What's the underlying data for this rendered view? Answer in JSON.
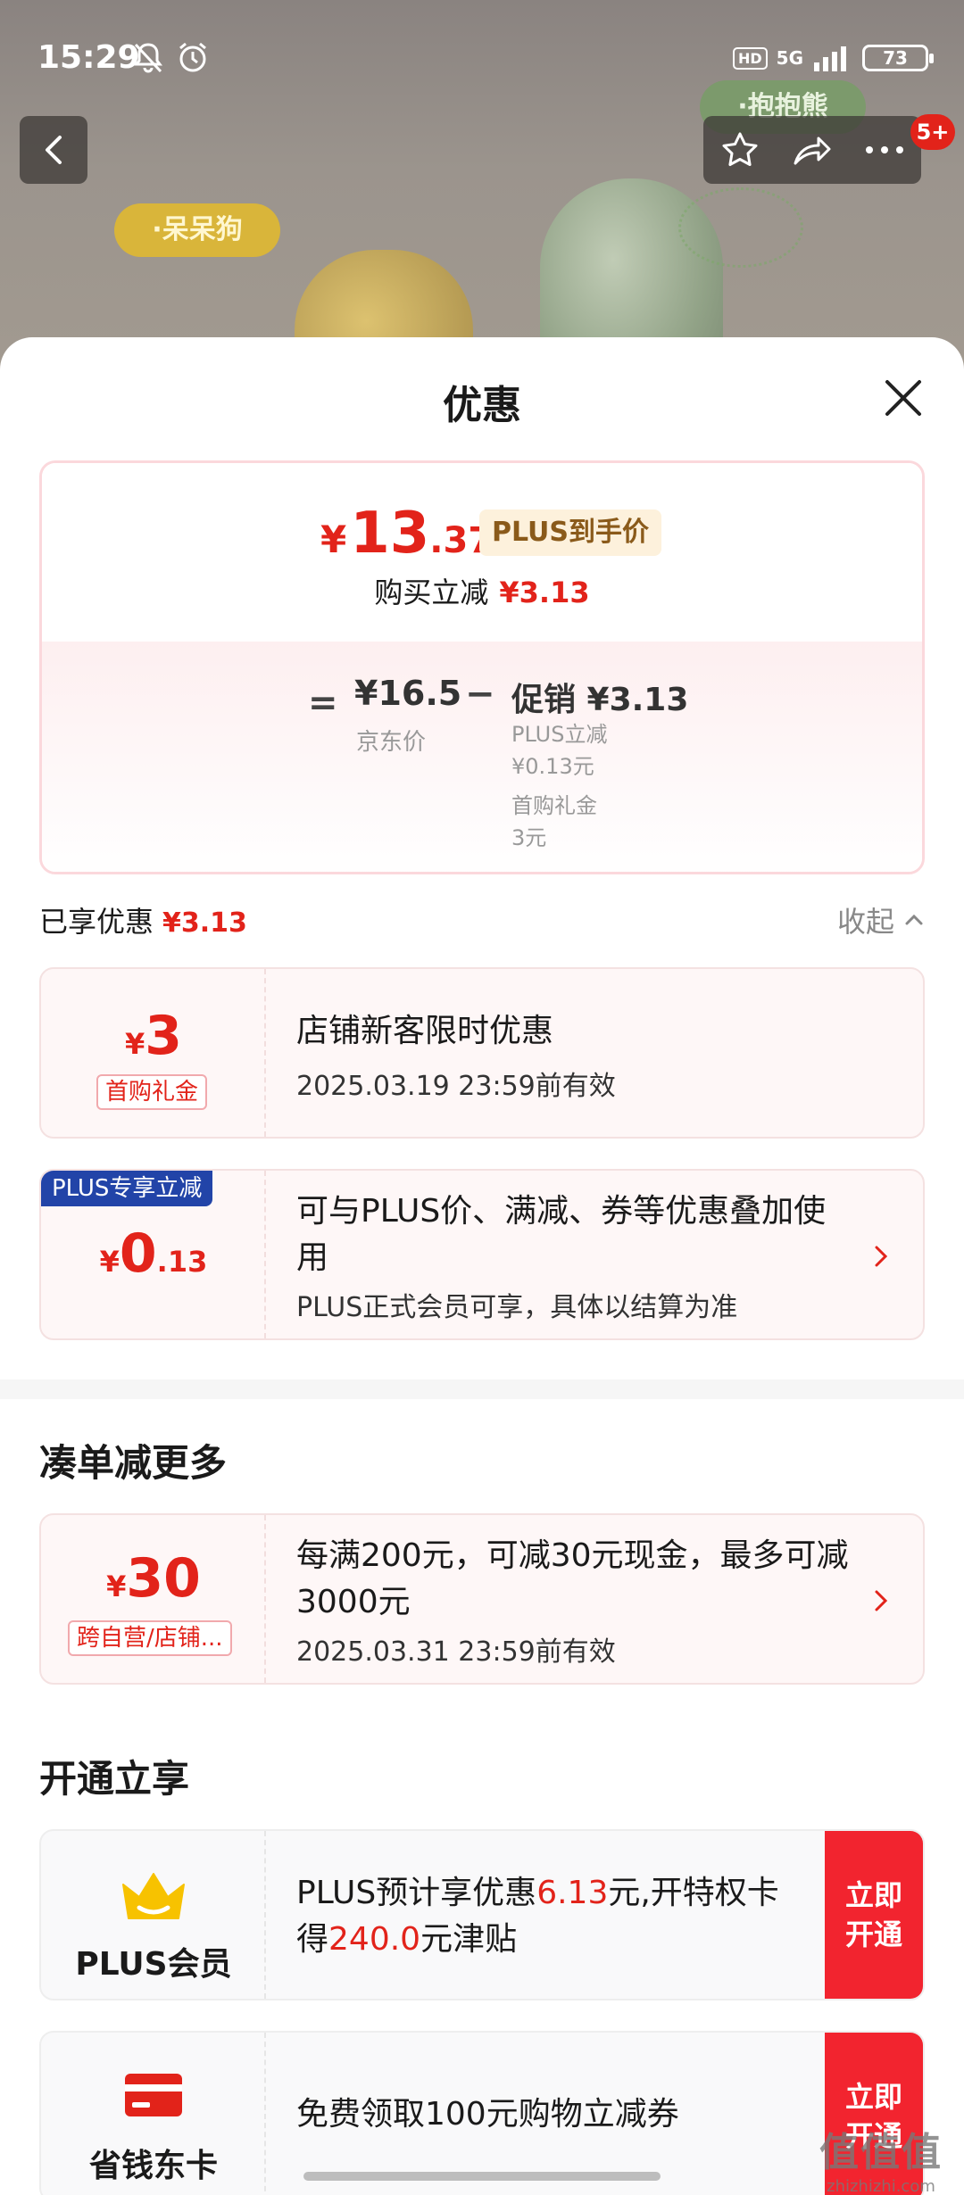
{
  "status": {
    "time": "15:29",
    "hd": "HD",
    "network": "5G",
    "battery": "73"
  },
  "background": {
    "tag_yellow": "·呆呆狗",
    "tag_green": "·抱抱熊"
  },
  "nav": {
    "badge": "5+"
  },
  "sheet": {
    "title": "优惠",
    "summary": {
      "currency": "¥",
      "price_int": "13",
      "price_dec": ".37",
      "plus_tag": "PLUS到手价",
      "instant_label": "购买立减",
      "instant_value": "¥3.13",
      "equals": "=",
      "jd_price": "¥16.5",
      "jd_label": "京东价",
      "minus": "−",
      "promo_title": "促销 ¥3.13",
      "promo_plus_label": "PLUS立减",
      "promo_plus_value": "¥0.13元",
      "promo_gift_label": "首购礼金",
      "promo_gift_value": "3元"
    },
    "enjoyed": {
      "label": "已享优惠",
      "value": "¥3.13",
      "collapse": "收起"
    },
    "coupons": [
      {
        "yen": "¥",
        "amount": "3",
        "decimal": "",
        "tag": "首购礼金",
        "title": "店铺新客限时优惠",
        "subtitle": "2025.03.19 23:59前有效"
      },
      {
        "ribbon": "PLUS专享立减",
        "yen": "¥",
        "amount": "0",
        "decimal": ".13",
        "title": "可与PLUS价、满减、券等优惠叠加使用",
        "subtitle": "PLUS正式会员可享，具体以结算为准"
      }
    ],
    "more": {
      "title": "凑单减更多",
      "coupon": {
        "yen": "¥",
        "amount": "30",
        "tag": "跨自营/店铺...",
        "title": "每满200元，可减30元现金，最多可减3000元",
        "subtitle": "2025.03.31 23:59前有效"
      }
    },
    "open": {
      "title": "开通立享",
      "members": [
        {
          "name": "PLUS会员",
          "desc_1": "PLUS预计享优惠",
          "desc_red_1": "6.13",
          "desc_2": "元,开特权卡得",
          "desc_red_2": "240.0",
          "desc_3": "元津贴",
          "cta": "立即开通",
          "icon": "crown-icon",
          "icon_color": "#f7c200"
        },
        {
          "name": "省钱东卡",
          "desc": "免费领取100元购物立减券",
          "cta": "立即开通",
          "icon": "card-icon",
          "icon_color": "#e2231a"
        }
      ]
    }
  },
  "watermark": {
    "line1": "值值值",
    "line2": "zhizhizhi.com"
  },
  "colors": {
    "accent": "#e2231a",
    "plus_blue": "#2244a8",
    "cta_red": "#f2242f"
  }
}
